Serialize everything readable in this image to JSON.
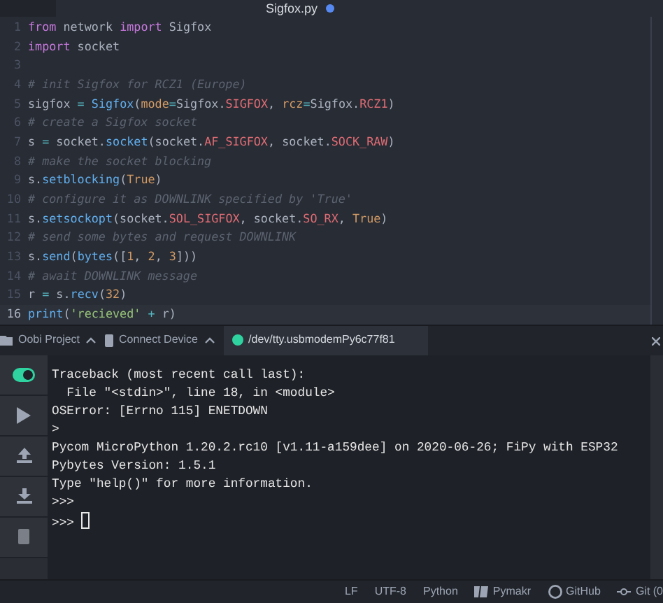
{
  "editor_tabs": [
    {
      "label": "Sigfox.py",
      "selected": true,
      "modified": true
    }
  ],
  "code_lines": [
    {
      "number": "1",
      "current": false,
      "tokens": [
        {
          "kind": "kw",
          "text": "from"
        },
        {
          "kind": "plain",
          "text": " network "
        },
        {
          "kind": "kw",
          "text": "import"
        },
        {
          "kind": "plain",
          "text": " Sigfox"
        }
      ]
    },
    {
      "number": "2",
      "current": false,
      "tokens": [
        {
          "kind": "kw",
          "text": "import"
        },
        {
          "kind": "plain",
          "text": " socket"
        }
      ]
    },
    {
      "number": "3",
      "current": false
    },
    {
      "number": "4",
      "current": false,
      "tokens": [
        {
          "kind": "comment",
          "text": "# init Sigfox for RCZ1 (Europe)"
        }
      ]
    },
    {
      "number": "5",
      "current": false,
      "tokens": [
        {
          "kind": "plain",
          "text": "sigfox"
        },
        {
          "kind": "op",
          "text": " = "
        },
        {
          "kind": "fn",
          "text": "Sigfox"
        },
        {
          "kind": "plain",
          "text": "("
        },
        {
          "kind": "param",
          "text": "mode"
        },
        {
          "kind": "op",
          "text": "="
        },
        {
          "kind": "plain",
          "text": "Sigfox."
        },
        {
          "kind": "const",
          "text": "SIGFOX"
        },
        {
          "kind": "plain",
          "text": ", "
        },
        {
          "kind": "param",
          "text": "rcz"
        },
        {
          "kind": "op",
          "text": "="
        },
        {
          "kind": "plain",
          "text": "Sigfox."
        },
        {
          "kind": "const",
          "text": "RCZ1"
        },
        {
          "kind": "plain",
          "text": ")"
        }
      ]
    },
    {
      "number": "6",
      "current": false,
      "tokens": [
        {
          "kind": "comment",
          "text": "# create a Sigfox socket"
        }
      ]
    },
    {
      "number": "7",
      "current": false,
      "tokens": [
        {
          "kind": "plain",
          "text": "s "
        },
        {
          "kind": "op",
          "text": "="
        },
        {
          "kind": "plain",
          "text": " socket."
        },
        {
          "kind": "fn",
          "text": "socket"
        },
        {
          "kind": "plain",
          "text": "(socket."
        },
        {
          "kind": "const",
          "text": "AF_SIGFOX"
        },
        {
          "kind": "plain",
          "text": ", socket."
        },
        {
          "kind": "const",
          "text": "SOCK_RAW"
        },
        {
          "kind": "plain",
          "text": ")"
        }
      ]
    },
    {
      "number": "8",
      "current": false,
      "tokens": [
        {
          "kind": "comment",
          "text": "# make the socket blocking"
        }
      ]
    },
    {
      "number": "9",
      "current": false,
      "tokens": [
        {
          "kind": "plain",
          "text": "s."
        },
        {
          "kind": "fn",
          "text": "setblocking"
        },
        {
          "kind": "plain",
          "text": "("
        },
        {
          "kind": "param",
          "text": "True"
        },
        {
          "kind": "plain",
          "text": ")"
        }
      ]
    },
    {
      "number": "10",
      "current": false,
      "tokens": [
        {
          "kind": "comment",
          "text": "# configure it as DOWNLINK specified by 'True'"
        }
      ]
    },
    {
      "number": "11",
      "current": false,
      "tokens": [
        {
          "kind": "plain",
          "text": "s."
        },
        {
          "kind": "fn",
          "text": "setsockopt"
        },
        {
          "kind": "plain",
          "text": "(socket."
        },
        {
          "kind": "const",
          "text": "SOL_SIGFOX"
        },
        {
          "kind": "plain",
          "text": ", socket."
        },
        {
          "kind": "const",
          "text": "SO_RX"
        },
        {
          "kind": "plain",
          "text": ", "
        },
        {
          "kind": "param",
          "text": "True"
        },
        {
          "kind": "plain",
          "text": ")"
        }
      ]
    },
    {
      "number": "12",
      "current": false,
      "tokens": [
        {
          "kind": "comment",
          "text": "# send some bytes and request DOWNLINK"
        }
      ]
    },
    {
      "number": "13",
      "current": false,
      "tokens": [
        {
          "kind": "plain",
          "text": "s."
        },
        {
          "kind": "fn",
          "text": "send"
        },
        {
          "kind": "plain",
          "text": "("
        },
        {
          "kind": "fn",
          "text": "bytes"
        },
        {
          "kind": "plain",
          "text": "(["
        },
        {
          "kind": "param",
          "text": "1"
        },
        {
          "kind": "plain",
          "text": ", "
        },
        {
          "kind": "param",
          "text": "2"
        },
        {
          "kind": "plain",
          "text": ", "
        },
        {
          "kind": "param",
          "text": "3"
        },
        {
          "kind": "plain",
          "text": "]))"
        }
      ]
    },
    {
      "number": "14",
      "current": false,
      "tokens": [
        {
          "kind": "comment",
          "text": "# await DOWNLINK message"
        }
      ]
    },
    {
      "number": "15",
      "current": false,
      "tokens": [
        {
          "kind": "plain",
          "text": "r "
        },
        {
          "kind": "op",
          "text": "="
        },
        {
          "kind": "plain",
          "text": " s."
        },
        {
          "kind": "fn",
          "text": "recv"
        },
        {
          "kind": "plain",
          "text": "("
        },
        {
          "kind": "param",
          "text": "32"
        },
        {
          "kind": "plain",
          "text": ")"
        }
      ]
    },
    {
      "number": "16",
      "current": true,
      "tokens": [
        {
          "kind": "fn",
          "text": "print"
        },
        {
          "kind": "plain",
          "text": "("
        },
        {
          "kind": "str",
          "text": "'recieved'"
        },
        {
          "kind": "op",
          "text": " + "
        },
        {
          "kind": "plain",
          "text": "r)"
        }
      ]
    }
  ],
  "panel_tabs": [
    {
      "kind": "folder",
      "label": "Oobi Project",
      "selected": false
    },
    {
      "kind": "device",
      "label": "Connect Device",
      "selected": false
    },
    {
      "kind": "status",
      "label": "/dev/tty.usbmodemPy6c77f81",
      "selected": true,
      "color": "#2ed3a0"
    }
  ],
  "toolbar": [
    {
      "kind": "toggle",
      "on": true
    },
    {
      "kind": "run"
    },
    {
      "kind": "upload"
    },
    {
      "kind": "download"
    },
    {
      "kind": "file"
    }
  ],
  "terminal_lines": [
    "Traceback (most recent call last):",
    "  File \"<stdin>\", line 18, in <module>",
    "OSError: [Errno 115] ENETDOWN",
    ">",
    "Pycom MicroPython 1.20.2.rc10 [v1.11-a159dee] on 2020-06-26; FiPy with ESP32",
    "Pybytes Version: 1.5.1",
    "Type \"help()\" for more information.",
    ">>>"
  ],
  "prompt": ">>>",
  "status_bar": [
    {
      "kind": "text",
      "label": "LF"
    },
    {
      "kind": "text",
      "label": "UTF-8"
    },
    {
      "kind": "text",
      "label": "Python"
    },
    {
      "kind": "pymakr",
      "label": "Pymakr"
    },
    {
      "kind": "github",
      "label": "GitHub"
    },
    {
      "kind": "git",
      "label": "Git (0"
    }
  ]
}
